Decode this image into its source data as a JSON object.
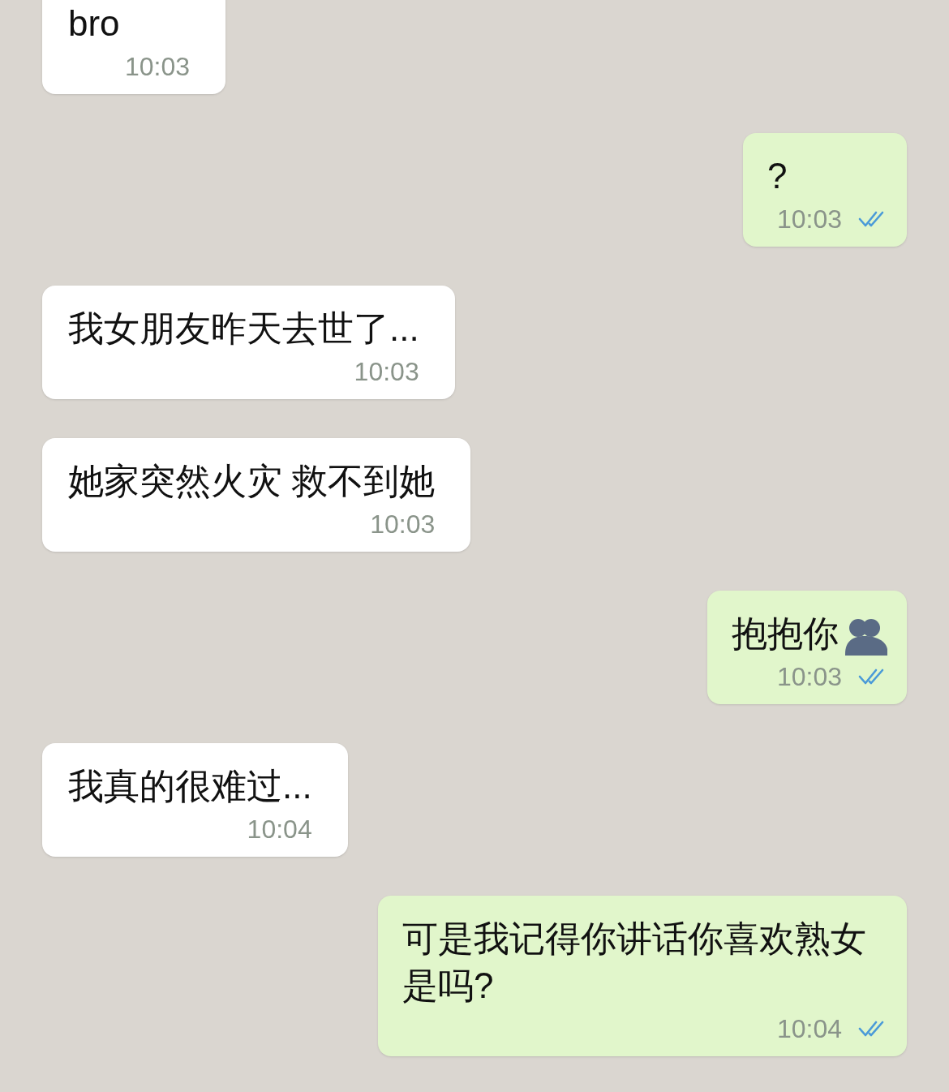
{
  "messages": [
    {
      "kind": "incoming",
      "text": "bro",
      "time": "10:03"
    },
    {
      "kind": "outgoing",
      "text": "?",
      "time": "10:03",
      "read": true
    },
    {
      "kind": "incoming",
      "text": "我女朋友昨天去世了...",
      "time": "10:03"
    },
    {
      "kind": "incoming",
      "text": "她家突然火灾 救不到她",
      "time": "10:03"
    },
    {
      "kind": "outgoing",
      "text": "抱抱你",
      "time": "10:03",
      "read": true,
      "trailing_emoji": true
    },
    {
      "kind": "incoming",
      "text": "我真的很难过...",
      "time": "10:04"
    },
    {
      "kind": "outgoing",
      "text": "可是我记得你讲话你喜欢熟女是吗?",
      "time": "10:04",
      "read": true
    }
  ]
}
